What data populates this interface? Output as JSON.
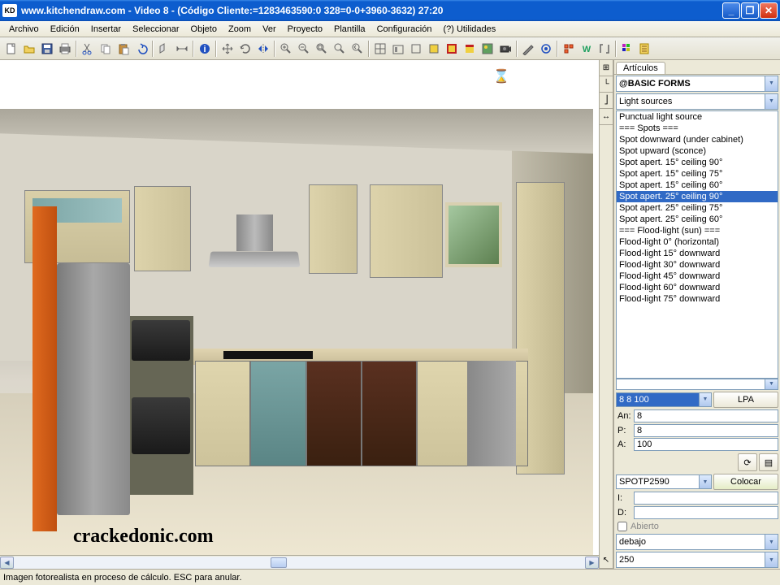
{
  "titlebar": {
    "app_icon": "KD",
    "title": "www.kitchendraw.com - Video 8 - (Código Cliente:=1283463590:0 328=0-0+3960-3632) 27:20"
  },
  "menu": [
    "Archivo",
    "Edición",
    "Insertar",
    "Seleccionar",
    "Objeto",
    "Zoom",
    "Ver",
    "Proyecto",
    "Plantilla",
    "Configuración",
    "(?) Utilidades"
  ],
  "right_panel": {
    "tab": "Artículos",
    "catalog": "@BASIC FORMS",
    "category": "Light sources",
    "items": [
      "Punctual light source",
      "=== Spots ===",
      "Spot downward (under cabinet)",
      "Spot upward (sconce)",
      "Spot apert. 15° ceiling 90°",
      "Spot apert. 15° ceiling 75°",
      "Spot apert. 15° ceiling 60°",
      "Spot apert. 25° ceiling 90°",
      "Spot apert. 25° ceiling 75°",
      "Spot apert. 25° ceiling 60°",
      "=== Flood-light (sun) ===",
      "Flood-light 0° (horizontal)",
      "Flood-light 15° downward",
      "Flood-light 30° downward",
      "Flood-light 45° downward",
      "Flood-light 60° downward",
      "Flood-light 75° downward"
    ],
    "selected_index": 7,
    "dims_combo": "8   8 100",
    "lpa_button": "LPA",
    "fields": {
      "an_label": "An:",
      "an": "8",
      "p_label": "P:",
      "p": "8",
      "a_label": "A:",
      "a": "100",
      "i_label": "I:",
      "i": "",
      "d_label": "D:",
      "d": ""
    },
    "code": "SPOTP2590",
    "place": "Colocar",
    "open_check": "Abierto",
    "pos_combo": "debajo",
    "height_combo": "250"
  },
  "status": "Imagen fotorealista en proceso de cálculo. ESC para anular.",
  "watermark": "crackedonic.com"
}
